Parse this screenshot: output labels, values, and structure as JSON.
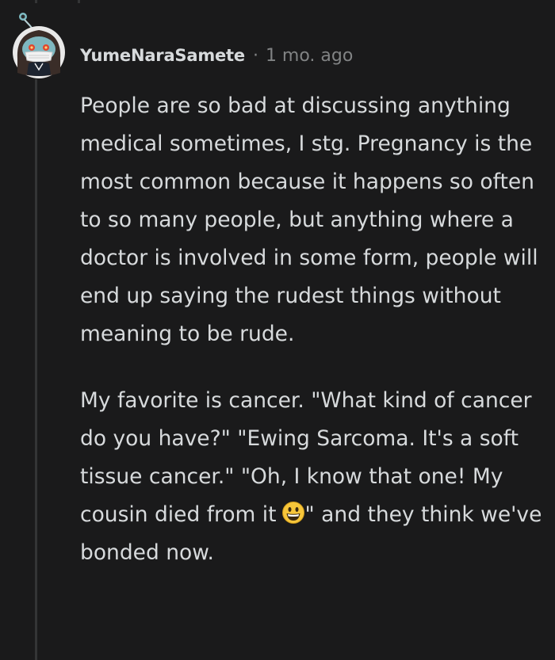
{
  "comment": {
    "username": "YumeNaraSamete",
    "separator": "·",
    "timestamp": "1 mo. ago",
    "paragraph_1": "People are so bad at discussing anything medical sometimes, I stg. Pregnancy is the most common because it happens so often to so many people, but anything where a doctor is involved in some form, people will end up saying the rudest things without meaning to be rude.",
    "paragraph_2_before_emoji": "My favorite is cancer. \"What kind of cancer do you have?\" \"Ewing Sarcoma. It's a soft tissue cancer.\" \"Oh, I know that one! My cousin died from it",
    "emoji": "grinning-face-emoji",
    "paragraph_2_after_emoji": "\" and they think we've bonded now."
  },
  "colors": {
    "background": "#1a1a1b",
    "text": "#d7dadc",
    "meta": "#818384",
    "thread_line": "#343536"
  }
}
